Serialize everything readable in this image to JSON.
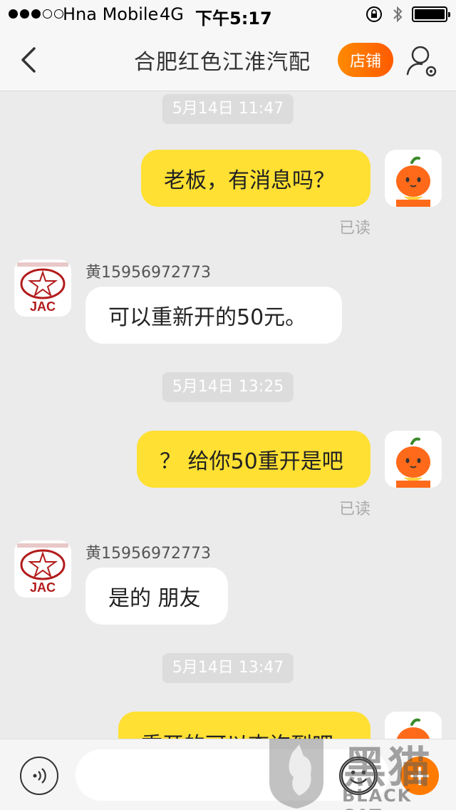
{
  "status_bar": {
    "carrier": "Hna Mobile",
    "network": "4G",
    "time": "下午5:17",
    "battery_level": 1.0
  },
  "nav": {
    "title": "合肥红色江淮汽配",
    "shop_button": "店铺"
  },
  "messages": [
    {
      "type": "timestamp",
      "text": "5月14日 11:47"
    },
    {
      "type": "outgoing",
      "text": "老板，有消息吗？",
      "status": "已读"
    },
    {
      "type": "incoming",
      "sender": "黄15956972773",
      "text": "可以重新开的50元。"
    },
    {
      "type": "timestamp",
      "text": "5月14日 13:25"
    },
    {
      "type": "outgoing",
      "text": "？ 给你50重开是吧",
      "status": "已读"
    },
    {
      "type": "incoming",
      "sender": "黄15956972773",
      "text": "是的 朋友"
    },
    {
      "type": "timestamp",
      "text": "5月14日 13:47"
    },
    {
      "type": "outgoing",
      "text": "重开的可以查询到吧"
    }
  ],
  "shop_avatar_text": "JAC",
  "input": {
    "placeholder": ""
  },
  "watermark": {
    "zh": "黑猫",
    "en": "BLACK CAT"
  },
  "colors": {
    "accent": "#ff7a00",
    "outgoing_bubble": "#ffe033",
    "incoming_bubble": "#ffffff",
    "background": "#ebebeb"
  }
}
